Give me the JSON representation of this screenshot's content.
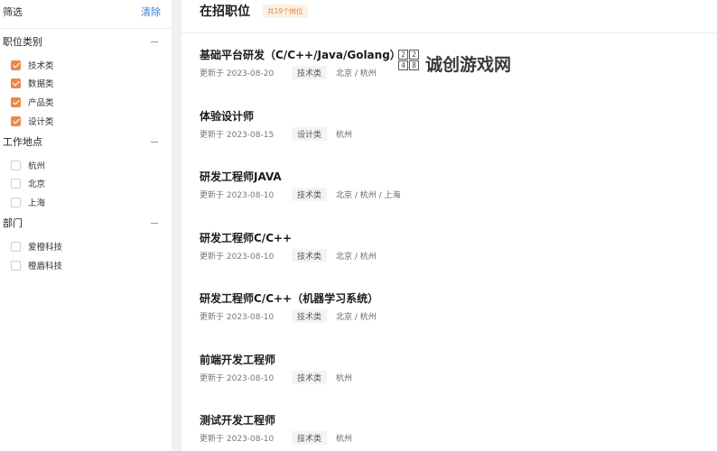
{
  "filter": {
    "title": "筛选",
    "clear_label": "清除"
  },
  "groups": [
    {
      "title": "职位类别",
      "options": [
        {
          "label": "技术类",
          "checked": true
        },
        {
          "label": "数据类",
          "checked": true
        },
        {
          "label": "产品类",
          "checked": true
        },
        {
          "label": "设计类",
          "checked": true
        }
      ]
    },
    {
      "title": "工作地点",
      "options": [
        {
          "label": "杭州",
          "checked": false
        },
        {
          "label": "北京",
          "checked": false
        },
        {
          "label": "上海",
          "checked": false
        }
      ]
    },
    {
      "title": "部门",
      "options": [
        {
          "label": "爱橙科技",
          "checked": false
        },
        {
          "label": "橙盾科技",
          "checked": false
        }
      ]
    }
  ],
  "main": {
    "title": "在招职位",
    "count_badge": "共19个岗位"
  },
  "jobs": [
    {
      "title": "基础平台研发（C/C++/Java/Golang）",
      "date": "更新于 2023-08-20",
      "category": "技术类",
      "location": "北京 / 杭州"
    },
    {
      "title": "体验设计师",
      "date": "更新于 2023-08-15",
      "category": "设计类",
      "location": "杭州"
    },
    {
      "title": "研发工程师JAVA",
      "date": "更新于 2023-08-10",
      "category": "技术类",
      "location": "北京 / 杭州 / 上海"
    },
    {
      "title": "研发工程师C/C++",
      "date": "更新于 2023-08-10",
      "category": "技术类",
      "location": "北京 / 杭州"
    },
    {
      "title": "研发工程师C/C++（机器学习系统）",
      "date": "更新于 2023-08-10",
      "category": "技术类",
      "location": "北京 / 杭州"
    },
    {
      "title": "前端开发工程师",
      "date": "更新于 2023-08-10",
      "category": "技术类",
      "location": "杭州"
    },
    {
      "title": "测试开发工程师",
      "date": "更新于 2023-08-10",
      "category": "技术类",
      "location": "杭州"
    }
  ],
  "watermark": {
    "logo_digits": [
      "2",
      "2",
      "4",
      "8"
    ],
    "text": "诚创游戏网"
  },
  "colors": {
    "accent_orange": "#e8894a",
    "link_blue": "#3d7fd4"
  }
}
